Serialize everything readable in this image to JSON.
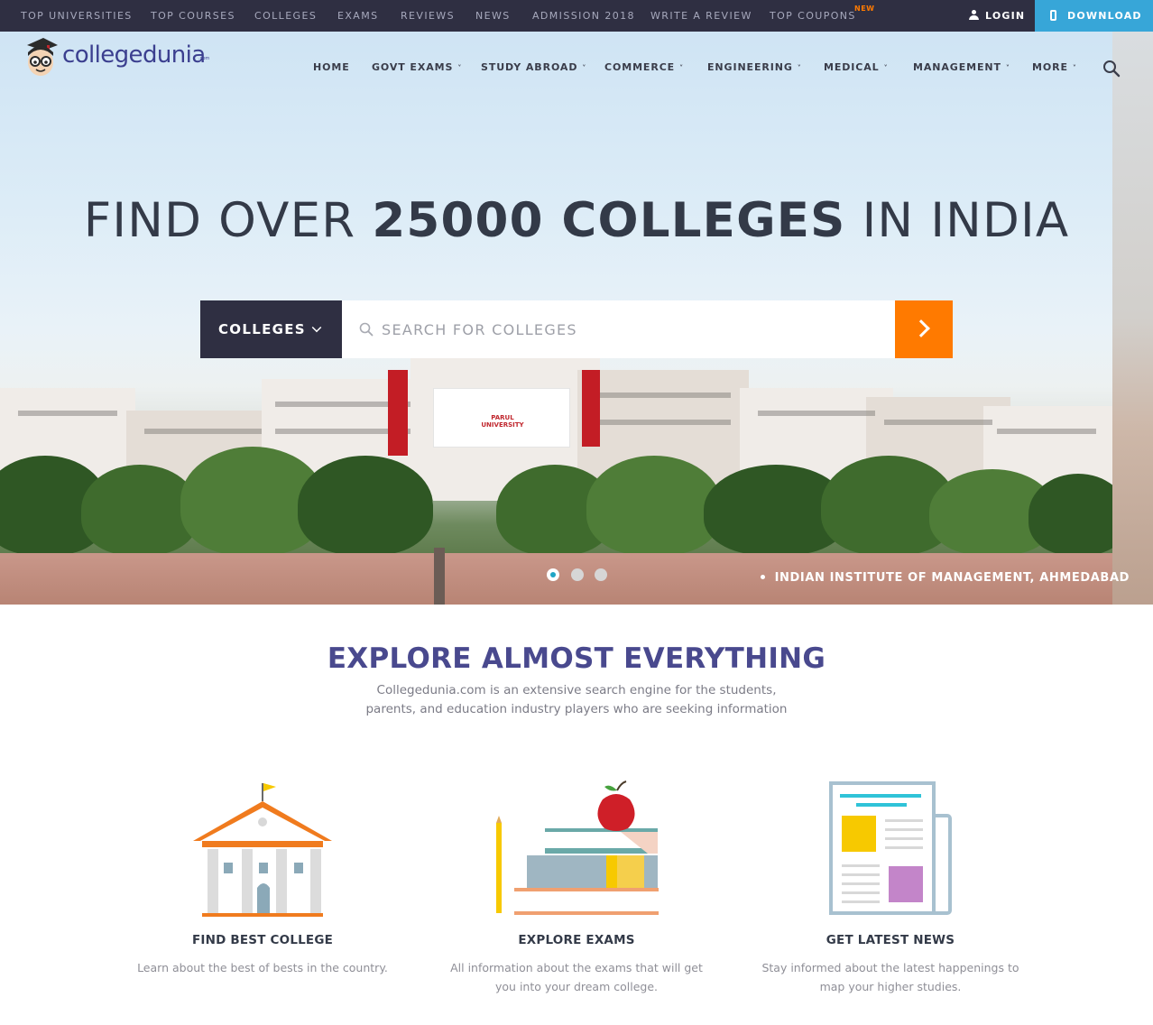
{
  "topbar": {
    "links": [
      {
        "label": "TOP UNIVERSITIES"
      },
      {
        "label": "TOP COURSES"
      },
      {
        "label": "COLLEGES"
      },
      {
        "label": "EXAMS"
      },
      {
        "label": "REVIEWS"
      },
      {
        "label": "NEWS"
      },
      {
        "label": "ADMISSION 2018"
      },
      {
        "label": "WRITE A REVIEW"
      },
      {
        "label": "TOP COUPONS"
      }
    ],
    "new_badge": "NEW",
    "login": "LOGIN",
    "download": "DOWNLOAD"
  },
  "logo": {
    "text": "collegedunia",
    "suffix": ".com"
  },
  "nav": {
    "items": [
      {
        "label": "HOME",
        "dropdown": ""
      },
      {
        "label": "GOVT EXAMS",
        "dropdown": "˅"
      },
      {
        "label": "STUDY ABROAD",
        "dropdown": "˅"
      },
      {
        "label": "COMMERCE",
        "dropdown": "˅"
      },
      {
        "label": "ENGINEERING",
        "dropdown": "˅"
      },
      {
        "label": "MEDICAL",
        "dropdown": "˅"
      },
      {
        "label": "MANAGEMENT",
        "dropdown": "˅"
      },
      {
        "label": "MORE",
        "dropdown": "˅"
      }
    ]
  },
  "hero": {
    "headline_pre": "FIND OVER ",
    "headline_bold": "25000 COLLEGES",
    "headline_post": " IN INDIA",
    "search_category": "COLLEGES",
    "search_placeholder": "SEARCH FOR COLLEGES",
    "caption": "INDIAN INSTITUTE OF MANAGEMENT, AHMEDABAD",
    "building_sign_line1": "PARUL",
    "building_sign_line2": "UNIVERSITY",
    "slide_count": 3,
    "active_slide": 1
  },
  "explore": {
    "title": "EXPLORE ALMOST EVERYTHING",
    "subtitle": "Collegedunia.com is an extensive search engine for the students, parents, and education industry players who are seeking information",
    "cards": [
      {
        "title": "FIND BEST COLLEGE",
        "desc": "Learn about the best of bests in the country.",
        "icon": "college-building-icon"
      },
      {
        "title": "EXPLORE EXAMS",
        "desc": "All information about the exams that will get you into your dream college.",
        "icon": "books-apple-icon"
      },
      {
        "title": "GET LATEST NEWS",
        "desc": "Stay informed about the latest happenings to map your higher studies.",
        "icon": "newspaper-icon"
      }
    ]
  },
  "colors": {
    "topbar_bg": "#2f2f42",
    "download_bg": "#37a6d8",
    "accent_orange": "#ff7a00",
    "title_purple": "#49498e"
  }
}
